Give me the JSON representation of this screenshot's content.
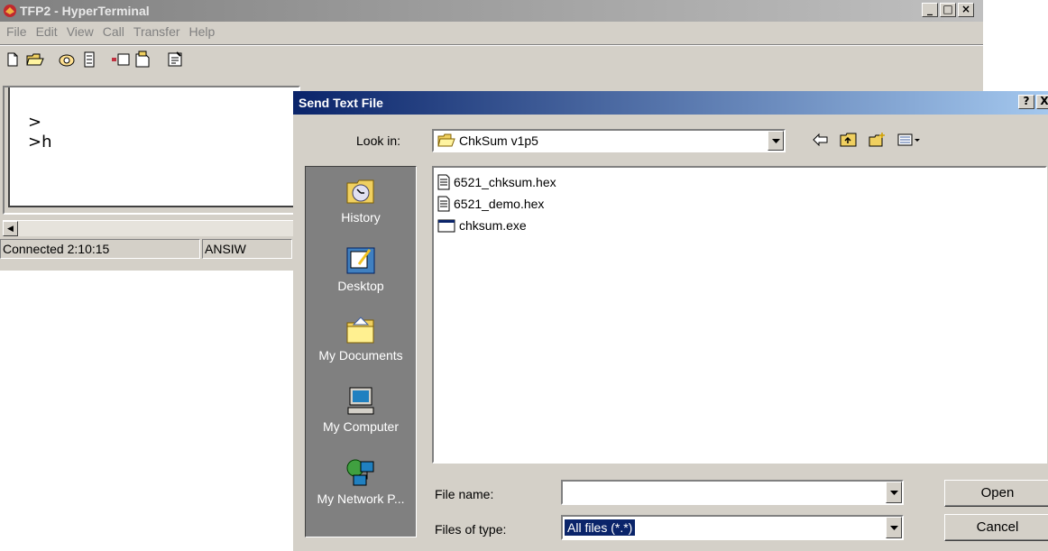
{
  "main_window": {
    "title": "TFP2 - HyperTerminal",
    "menu": [
      "File",
      "Edit",
      "View",
      "Call",
      "Transfer",
      "Help"
    ],
    "terminal_lines": [
      ">",
      ">h"
    ],
    "status": {
      "connected": "Connected 2:10:15",
      "emulation": "ANSIW"
    }
  },
  "dialog": {
    "title": "Send Text File",
    "help_button": "?",
    "close_button": "X",
    "look_in_label": "Look in:",
    "look_in_value": "ChkSum v1p5",
    "places": [
      {
        "label": "History",
        "icon": "history-icon"
      },
      {
        "label": "Desktop",
        "icon": "desktop-icon"
      },
      {
        "label": "My Documents",
        "icon": "my-documents-icon"
      },
      {
        "label": "My Computer",
        "icon": "my-computer-icon"
      },
      {
        "label": "My Network P...",
        "icon": "my-network-places-icon"
      }
    ],
    "files": [
      {
        "name": "6521_chksum.hex",
        "icon": "text-file-icon"
      },
      {
        "name": "6521_demo.hex",
        "icon": "text-file-icon"
      },
      {
        "name": "chksum.exe",
        "icon": "exe-file-icon"
      }
    ],
    "file_name_label": "File name:",
    "file_name_value": "",
    "files_of_type_label": "Files of type:",
    "files_of_type_value": "All files (*.*)",
    "open_button": "Open",
    "cancel_button": "Cancel"
  },
  "colors": {
    "face": "#d4d0c8",
    "active_title": "#0a246a",
    "inactive_title": "#808080",
    "places_bar": "#808080"
  }
}
